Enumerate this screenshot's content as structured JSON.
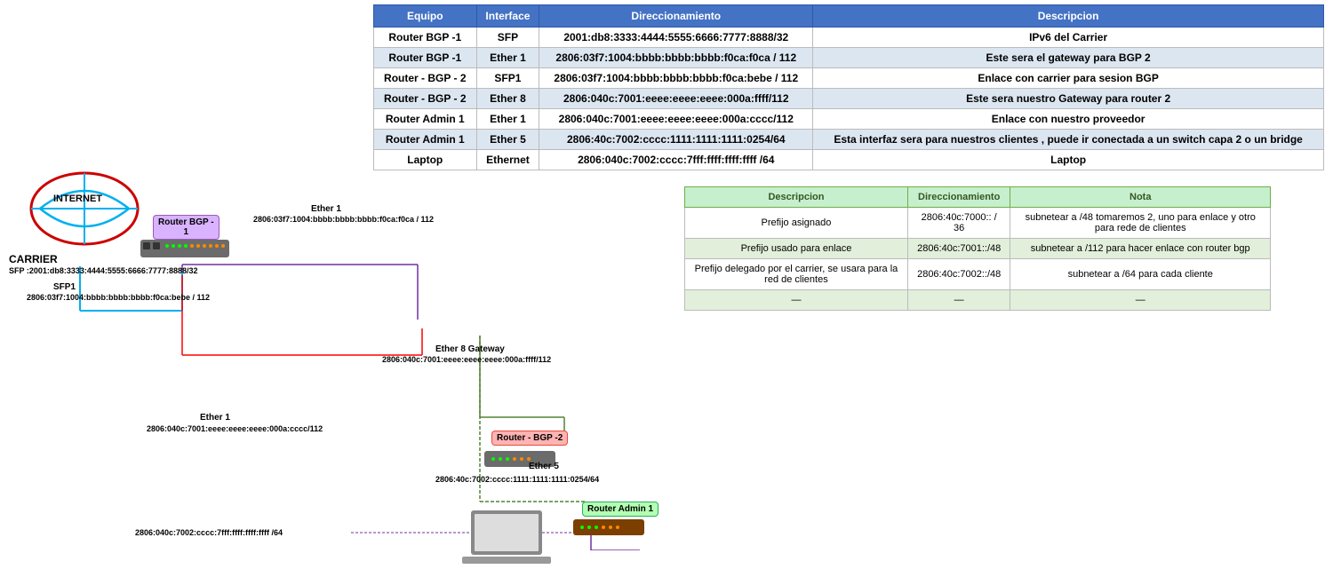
{
  "mainTable": {
    "headers": [
      "Equipo",
      "Interface",
      "Direccionamiento",
      "Descripcion"
    ],
    "rows": [
      {
        "equipo": "Router BGP -1",
        "interface": "SFP",
        "direccionamiento": "2001:db8:3333:4444:5555:6666:7777:8888/32",
        "descripcion": "IPv6 del Carrier"
      },
      {
        "equipo": "Router BGP -1",
        "interface": "Ether 1",
        "direccionamiento": "2806:03f7:1004:bbbb:bbbb:bbbb:f0ca:f0ca / 112",
        "descripcion": "Este sera el gateway para BGP 2"
      },
      {
        "equipo": "Router - BGP - 2",
        "interface": "SFP1",
        "direccionamiento": "2806:03f7:1004:bbbb:bbbb:bbbb:f0ca:bebe / 112",
        "descripcion": "Enlace con carrier para sesion BGP"
      },
      {
        "equipo": "Router - BGP - 2",
        "interface": "Ether 8",
        "direccionamiento": "2806:040c:7001:eeee:eeee:eeee:000a:ffff/112",
        "descripcion": "Este sera nuestro Gateway para router 2"
      },
      {
        "equipo": "Router Admin 1",
        "interface": "Ether 1",
        "direccionamiento": "2806:040c:7001:eeee:eeee:eeee:000a:cccc/112",
        "descripcion": "Enlace con nuestro proveedor"
      },
      {
        "equipo": "Router Admin 1",
        "interface": "Ether 5",
        "direccionamiento": "2806:40c:7002:cccc:1111:1111:1111:0254/64",
        "descripcion": "Esta interfaz sera para nuestros clientes , puede ir conectada a un switch capa 2 o un bridge"
      },
      {
        "equipo": "Laptop",
        "interface": "Ethernet",
        "direccionamiento": "2806:040c:7002:cccc:7fff:ffff:ffff:ffff /64",
        "descripcion": "Laptop"
      }
    ]
  },
  "secondTable": {
    "headers": [
      "Descripcion",
      "Direccionamiento",
      "Nota"
    ],
    "rows": [
      {
        "descripcion": "Prefijo asignado",
        "direccionamiento": "2806:40c:7000:: / 36",
        "nota": "subnetear a /48  tomaremos 2, uno para enlace y otro para rede de clientes"
      },
      {
        "descripcion": "Prefijo usado para enlace",
        "direccionamiento": "2806:40c:7001::/48",
        "nota": "subnetear a /112 para hacer enlace con router bgp"
      },
      {
        "descripcion": "Prefijo delegado por el carrier, se usara para la red de clientes",
        "direccionamiento": "2806:40c:7002::/48",
        "nota": "subnetear a /64 para cada cliente"
      },
      {
        "descripcion": "—",
        "direccionamiento": "—",
        "nota": "—"
      }
    ]
  },
  "diagram": {
    "internet": "INTERNET",
    "carrier": "CARRIER",
    "carrierAddr": "SFP :2001:db8:3333:4444:5555:6666:7777:8888/32",
    "routerBGP1": "Router BGP -\n1",
    "routerBGP2": "Router - BGP -2",
    "routerAdmin1": "Router Admin 1",
    "laptop": "Laptop",
    "ether1Label": "Ether 1",
    "ether1Addr": "2806:03f7:1004:bbbb:bbbb:bbbb:f0ca:f0ca / 112",
    "sfp1Label": "SFP1",
    "sfp1Addr": "2806:03f7:1004:bbbb:bbbb:bbbb:f0ca:bebe / 112",
    "ether8Label": "Ether 8 Gateway",
    "ether8Addr": "2806:040c:7001:eeee:eeee:eeee:000a:ffff/112",
    "ether1Admin1Label": "Ether 1",
    "ether1Admin1Addr": "2806:040c:7001:eeee:eeee:eeee:000a:cccc/112",
    "ether5Label": "Ether 5",
    "ether5Addr": "2806:40c:7002:cccc:1111:1111:1111:0254/64",
    "laptopAddr": "2806:040c:7002:cccc:7fff:ffff:ffff:ffff /64"
  }
}
